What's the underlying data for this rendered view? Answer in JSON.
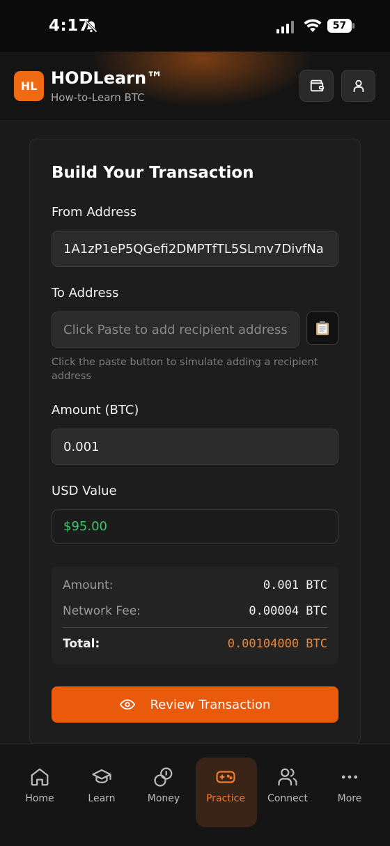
{
  "status": {
    "time": "4:17",
    "battery": "57"
  },
  "header": {
    "logo": "HL",
    "title": "HODLearn™",
    "subtitle": "How-to-Learn BTC"
  },
  "form": {
    "title": "Build Your Transaction",
    "from_label": "From Address",
    "from_value": "1A1zP1eP5QGefi2DMPTfTL5SLmv7DivfNa",
    "to_label": "To Address",
    "to_placeholder": "Click Paste to add recipient address",
    "paste_icon": "clipboard-icon",
    "helper": "Click the paste button to simulate adding a recipient address",
    "amount_label": "Amount (BTC)",
    "amount_value": "0.001",
    "usd_label": "USD Value",
    "usd_value": "$95.00"
  },
  "summary": {
    "amount_label": "Amount:",
    "amount_value": "0.001 BTC",
    "fee_label": "Network Fee:",
    "fee_value": "0.00004 BTC",
    "total_label": "Total:",
    "total_value": "0.00104000 BTC"
  },
  "review_button": {
    "label": "Review Transaction",
    "icon": "eye-icon"
  },
  "nav": [
    {
      "label": "Home",
      "icon": "home-icon"
    },
    {
      "label": "Learn",
      "icon": "graduation-cap-icon"
    },
    {
      "label": "Money",
      "icon": "coins-icon"
    },
    {
      "label": "Practice",
      "icon": "gamepad-icon",
      "active": true
    },
    {
      "label": "Connect",
      "icon": "users-icon"
    },
    {
      "label": "More",
      "icon": "more-dots-icon"
    }
  ],
  "colors": {
    "accent": "#ea5a0c",
    "usd_green": "#3fc46a",
    "total_orange": "#e8873a"
  }
}
